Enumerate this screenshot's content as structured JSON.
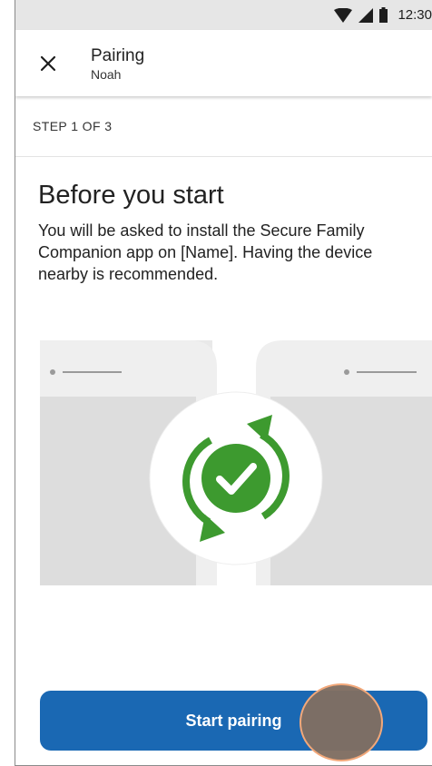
{
  "status_bar": {
    "time": "12:30",
    "icons": [
      "wifi-icon",
      "cell-signal-icon",
      "battery-icon"
    ]
  },
  "app_bar": {
    "title": "Pairing",
    "subtitle": "Noah",
    "close_icon": "close-icon"
  },
  "step": {
    "label": "STEP 1 OF 3"
  },
  "content": {
    "heading": "Before you start",
    "body": "You will be asked to install the Secure Family Companion app on [Name]. Having the device nearby is recommended."
  },
  "illustration": {
    "icon": "sync-check-icon",
    "accent_color": "#3d9a2f"
  },
  "actions": {
    "primary_label": "Start pairing",
    "primary_color": "#1a68b3"
  }
}
